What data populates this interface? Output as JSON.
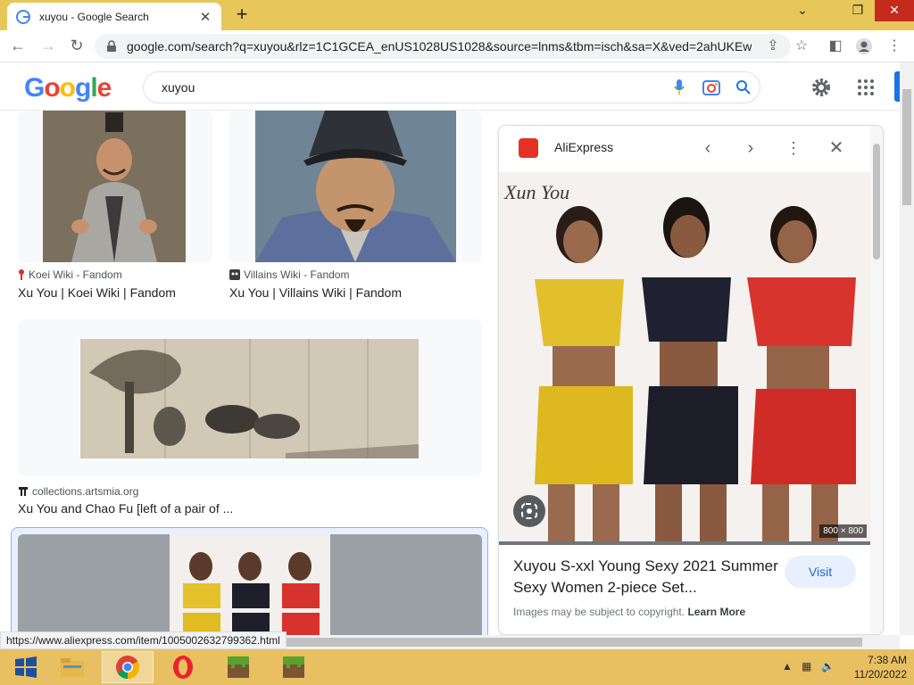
{
  "browser": {
    "tab_title": "xuyou - Google Search",
    "tab_close": "✕",
    "new_tab": "+",
    "url": "google.com/search?q=xuyou&rlz=1C1GCEA_enUS1028US1028&source=lnms&tbm=isch&sa=X&ved=2ahUKEw...",
    "window_controls": {
      "minimize": "⌄",
      "restore": "❐",
      "close": "✕"
    }
  },
  "google": {
    "logo_letters": [
      "G",
      "o",
      "o",
      "g",
      "l",
      "e"
    ],
    "logo_colors": [
      "#4285F4",
      "#EA4335",
      "#FBBC05",
      "#4285F4",
      "#34A853",
      "#EA4335"
    ],
    "search_value": "xuyou"
  },
  "results": [
    {
      "source": "Koei Wiki - Fandom",
      "title": "Xu You | Koei Wiki | Fandom"
    },
    {
      "source": "Villains Wiki - Fandom",
      "title": "Xu You | Villains Wiki | Fandom"
    },
    {
      "source": "collections.artsmia.org",
      "title": "Xu You and Chao Fu [left of a pair of ..."
    }
  ],
  "preview": {
    "site": "AliExpress",
    "image_text": "Xun You",
    "dimensions": "800 × 800",
    "title": "Xuyou S-xxl Young Sexy 2021 Summer Sexy Women 2-piece Set...",
    "visit_label": "Visit",
    "copyright_note": "Images may be subject to copyright.",
    "learn_more": "Learn More"
  },
  "status_url": "https://www.aliexpress.com/item/1005002632799362.html",
  "taskbar": {
    "time": "7:38 AM",
    "date": "11/20/2022"
  },
  "colors": {
    "taskbar": "#e8c062",
    "tabstrip": "#e8c75a",
    "accent_blue": "#1a73e8"
  }
}
